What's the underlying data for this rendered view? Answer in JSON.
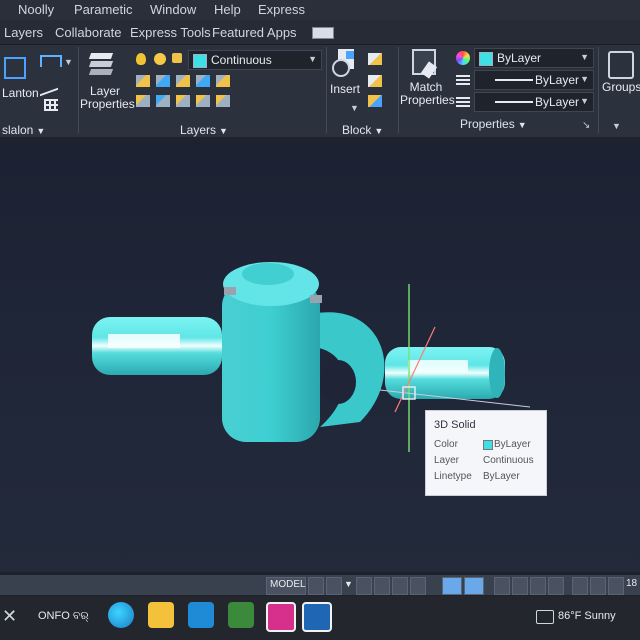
{
  "menubar": {
    "items": [
      "Noolly",
      "Parametic",
      "Window",
      "Help",
      "Express"
    ]
  },
  "tabs": {
    "items": [
      "Layers",
      "Collaborate",
      "Express Tools",
      "Featured Apps"
    ]
  },
  "ribbon": {
    "left_panel": {
      "label": "Lanton",
      "title": "slalon"
    },
    "layers_panel": {
      "layer_properties_label": "Layer\nProperties",
      "current_layer": "Continuous",
      "title": "Layers"
    },
    "block_panel": {
      "insert_label": "Insert",
      "title": "Block"
    },
    "properties_panel": {
      "match_label": "Match\nProperties",
      "color_value": "ByLayer",
      "lineweight_value": "ByLayer",
      "linetype_value": "ByLayer",
      "title": "Properties"
    },
    "groups_panel": {
      "label": "Groups"
    }
  },
  "tooltip": {
    "title": "3D Solid",
    "rows": [
      {
        "key": "Color",
        "value": "ByLayer"
      },
      {
        "key": "Layer",
        "value": "Continuous"
      },
      {
        "key": "Linetype",
        "value": "ByLayer"
      }
    ]
  },
  "statusbar": {
    "model_label": "MODEL",
    "right_text": "18"
  },
  "taskbar": {
    "lang_text": "ONFO ବର୍",
    "weather": "86°F Sunny"
  },
  "colors": {
    "solid": "#3fe0e5",
    "viewport_bg": "#1f2536",
    "ribbon_bg": "#2c323d",
    "accent_cyan": "#28c7c9"
  }
}
